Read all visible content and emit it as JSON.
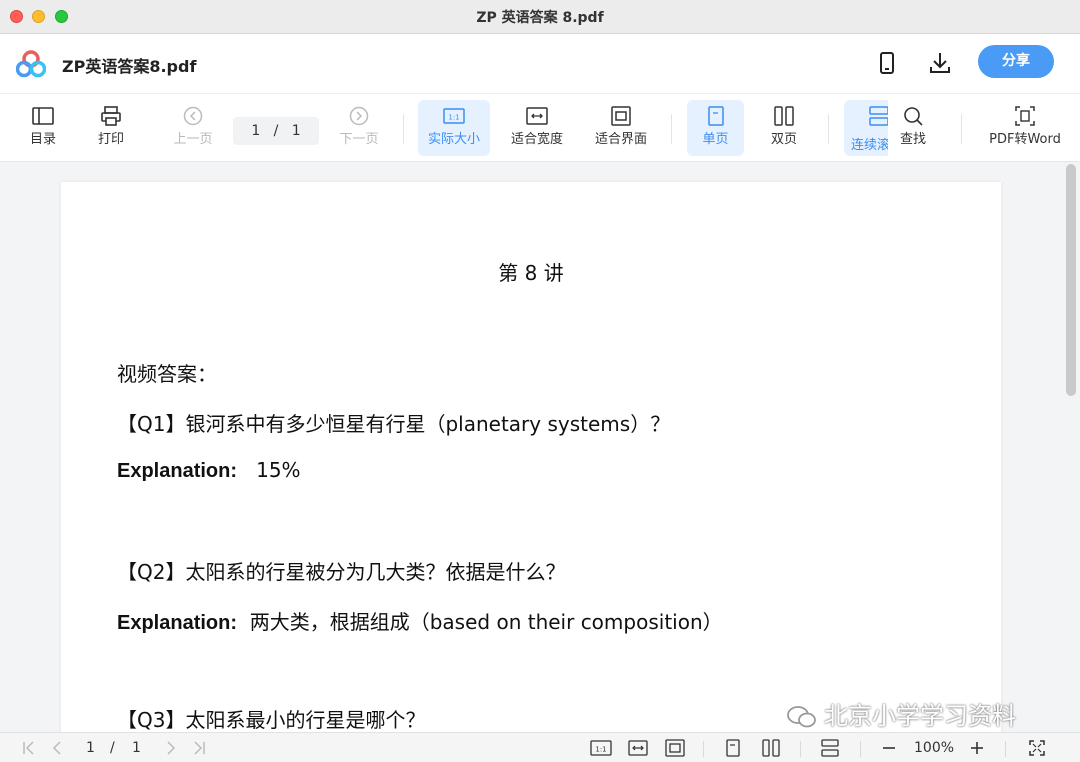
{
  "window": {
    "title": "ZP 英语答案 8.pdf"
  },
  "header": {
    "file_name": "ZP英语答案8.pdf",
    "share_label": "分享"
  },
  "toolbar": {
    "toc": "目录",
    "print": "打印",
    "prev": "上一页",
    "page_current": "1",
    "page_sep": "/",
    "page_total": "1",
    "next": "下一页",
    "actual_size": "实际大小",
    "fit_width": "适合宽度",
    "fit_page": "适合界面",
    "single": "单页",
    "double": "双页",
    "continuous": "连续滚",
    "search": "查找",
    "pdf_to_word": "PDF转Word"
  },
  "document": {
    "title": "第 8 讲",
    "section": "视频答案：",
    "q1": "【Q1】银河系中有多少恒星有行星（planetary systems）？",
    "q1_label": "Explanation:",
    "q1_answer": "15%",
    "q2": "【Q2】太阳系的行星被分为几大类？依据是什么？",
    "q2_label": "Explanation:",
    "q2_answer": "两大类，根据组成（based on their composition）",
    "q3": "【Q3】太阳系最小的行星是哪个？"
  },
  "watermark": "北京小学学习资料",
  "bottombar": {
    "page_current": "1",
    "page_sep": "/",
    "page_total": "1",
    "zoom": "100%"
  },
  "colors": {
    "accent": "#4a9bf5",
    "active_bg": "#e6f1ff",
    "doc_bg": "#f3f4f6"
  }
}
